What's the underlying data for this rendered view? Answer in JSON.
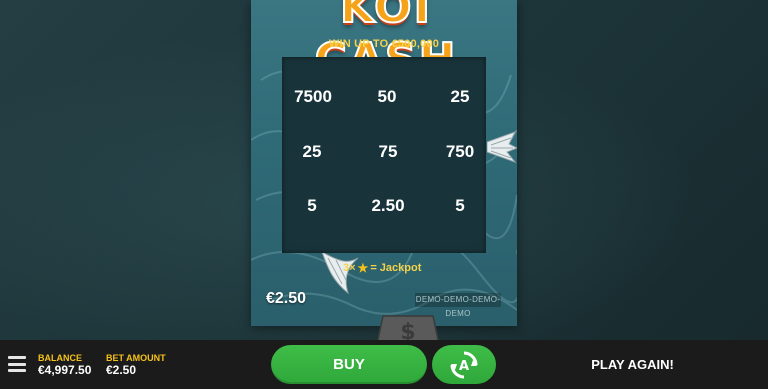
{
  "ticket": {
    "logo_text": "KOI CASH",
    "subtitle": "WIN UP TO €500,000",
    "grid": [
      [
        "7500",
        "50",
        "25"
      ],
      [
        "25",
        "75",
        "750"
      ],
      [
        "5",
        "2.50",
        "5"
      ]
    ],
    "rule": {
      "count": "3×",
      "icon": "star-icon",
      "result": "= Jackpot"
    },
    "price": "€2.50",
    "watermark": "DEMO-DEMO-DEMO-DEMO"
  },
  "bottom_bar": {
    "balance_label": "BALANCE",
    "balance_value": "€4,997.50",
    "bet_label": "BET AMOUNT",
    "bet_value": "€2.50",
    "buy_label": "BUY",
    "auto_icon": "autoplay-icon",
    "play_again_label": "PLAY AGAIN!"
  },
  "colors": {
    "background": "#1d3539",
    "ticket": "#2f6a77",
    "play_area": "#18343a",
    "accent_yellow": "#f6d24a",
    "logo_orange": "#f6a31a",
    "button_green": "#34b03f",
    "bar": "#1b1b1b"
  }
}
